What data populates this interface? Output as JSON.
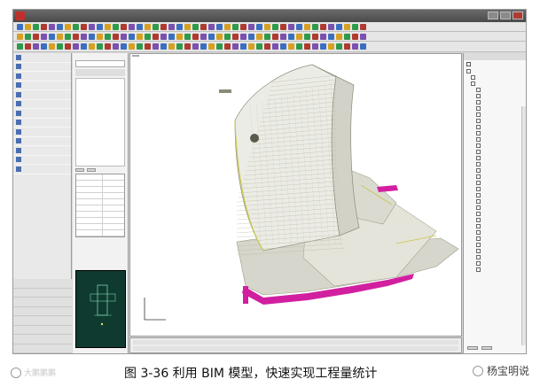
{
  "caption": "图 3-36 利用 BIM 模型，快速实现工程量统计",
  "watermark_left": "大鹏鹏鹏",
  "watermark_right": "杨宝明说",
  "left_panel": {
    "items": [
      "",
      "",
      "",
      "",
      "",
      "",
      "",
      "",
      "",
      "",
      "",
      "",
      ""
    ],
    "bottom_items": [
      "",
      "",
      "",
      "",
      "",
      "",
      "",
      ""
    ]
  },
  "props_panel": {
    "combo_value": "",
    "row_value": "",
    "tabs": [
      "",
      ""
    ],
    "grid_rows": [
      [
        "",
        ""
      ],
      [
        "",
        ""
      ],
      [
        "",
        ""
      ],
      [
        "",
        ""
      ],
      [
        "",
        ""
      ],
      [
        "",
        ""
      ],
      [
        "",
        ""
      ],
      [
        "",
        ""
      ],
      [
        "",
        ""
      ],
      [
        "",
        ""
      ]
    ]
  },
  "viewport": {
    "tab_label": ""
  },
  "right_panel": {
    "header": "",
    "checkbox_label": "",
    "tree": [
      "",
      "",
      "",
      "",
      "",
      "",
      "",
      "",
      "",
      "",
      "",
      "",
      "",
      "",
      "",
      "",
      "",
      "",
      "",
      "",
      "",
      "",
      "",
      "",
      "",
      "",
      "",
      "",
      "",
      "",
      "",
      "",
      ""
    ],
    "buttons": [
      "",
      ""
    ]
  },
  "colors": {
    "model_magenta": "#d21fa0",
    "model_gray": "#cfcfcf",
    "model_yellow": "#c9c64a",
    "minimap_bg": "#0e3a30"
  }
}
